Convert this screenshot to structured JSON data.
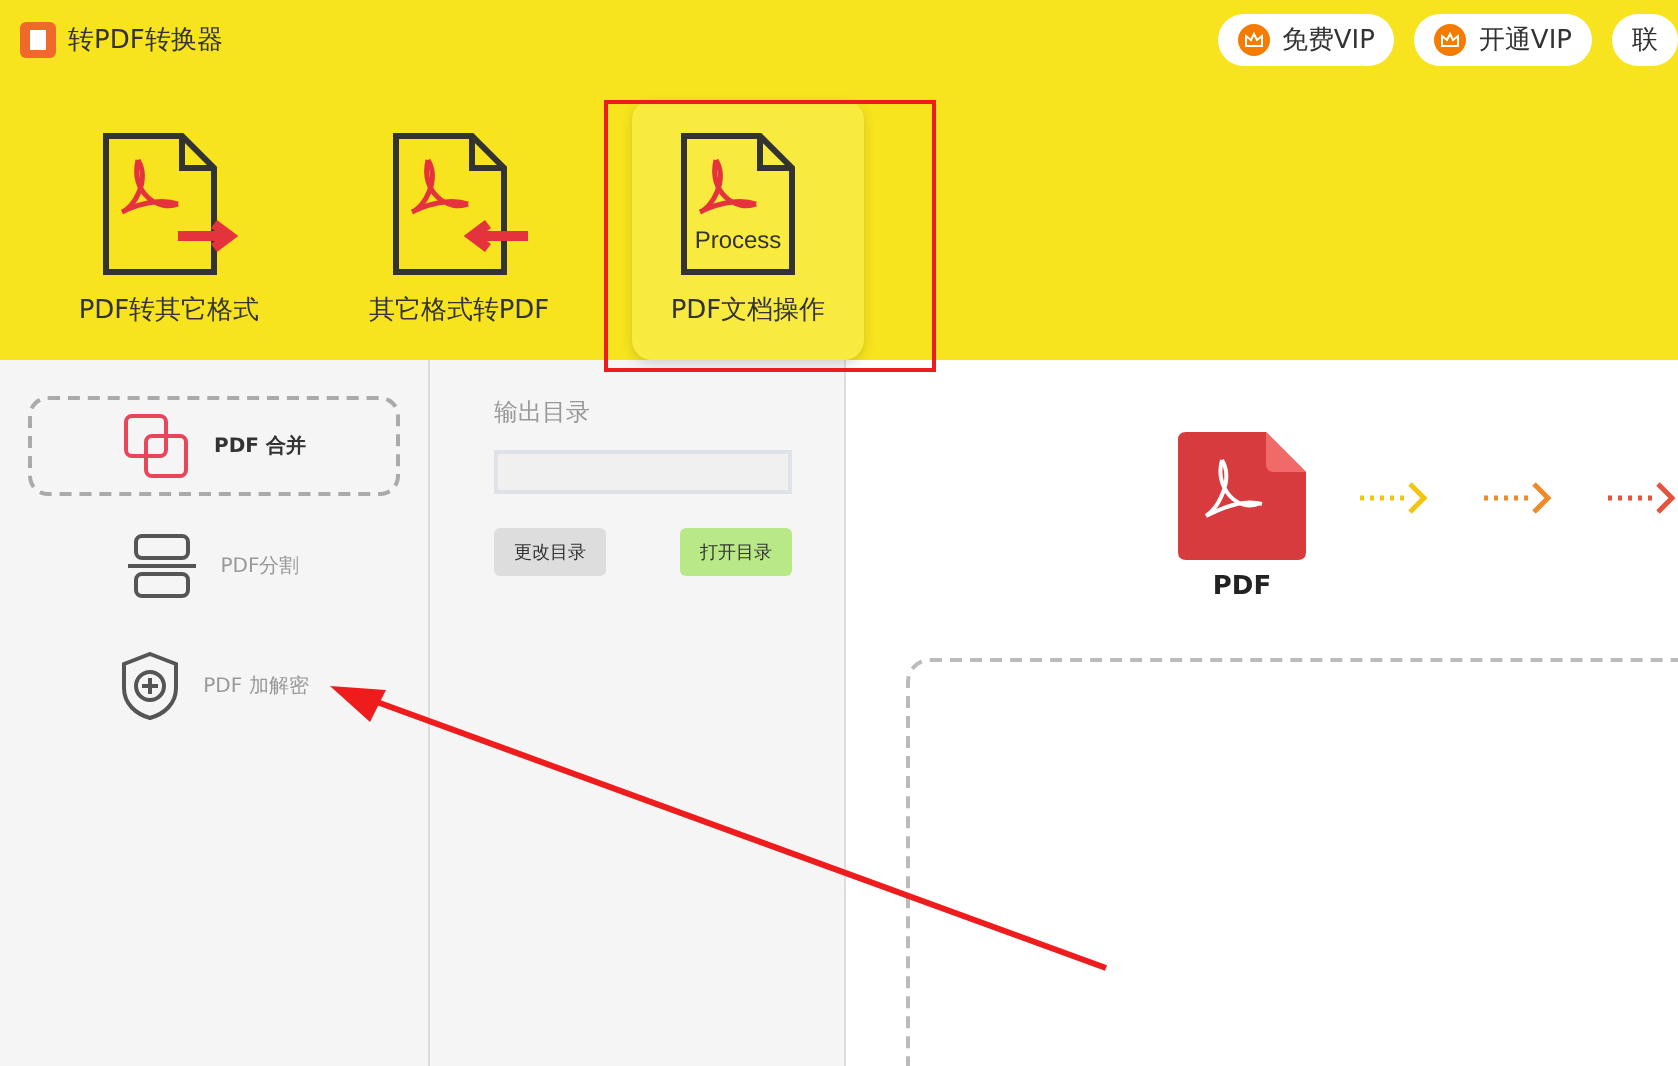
{
  "window": {
    "title": "转PDF转换器"
  },
  "header_buttons": [
    {
      "label": "免费VIP",
      "kind": "vip"
    },
    {
      "label": "开通VIP",
      "kind": "vip"
    },
    {
      "label": "联",
      "kind": "plain"
    }
  ],
  "tools": [
    {
      "label": "PDF转其它格式",
      "kind": "export",
      "selected": false
    },
    {
      "label": "其它格式转PDF",
      "kind": "import",
      "selected": false
    },
    {
      "label": "PDF文档操作",
      "kind": "process",
      "icon_text": "Process",
      "selected": true
    }
  ],
  "sidebar": {
    "items": [
      {
        "label": "PDF 合并",
        "kind": "merge",
        "selected": true
      },
      {
        "label": "PDF分割",
        "kind": "split",
        "selected": false
      },
      {
        "label": "PDF 加解密",
        "kind": "encrypt",
        "selected": false
      }
    ]
  },
  "output": {
    "label": "输出目录",
    "buttons": [
      {
        "label": "更改目录",
        "kind": "change"
      },
      {
        "label": "打开目录",
        "kind": "open"
      }
    ]
  },
  "flow": {
    "file_label": "PDF"
  }
}
